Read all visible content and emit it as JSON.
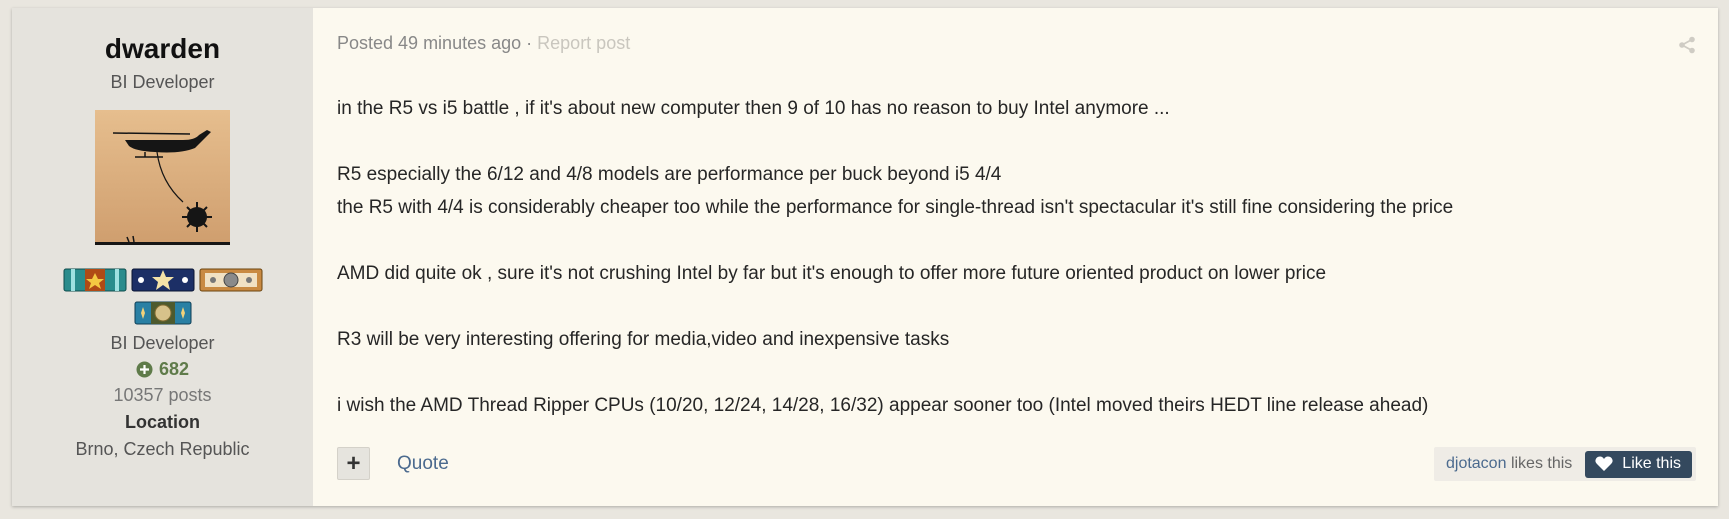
{
  "author": {
    "name": "dwarden",
    "title": "BI Developer",
    "group": "BI Developer",
    "reputation": "682",
    "posts": "10357 posts",
    "location_label": "Location",
    "location_value": "Brno, Czech Republic",
    "badges": [
      "star-ribbon-badge",
      "stars-ribbon-badge",
      "medal-badge",
      "emblem-badge"
    ]
  },
  "post": {
    "posted": "Posted 49 minutes ago",
    "separator": "·",
    "report": "Report post",
    "lines": [
      "in the R5 vs i5 battle , if it's about new computer then 9 of 10 has no reason to buy Intel anymore ...",
      "",
      "R5 especially the 6/12 and 4/8 models are performance per buck beyond i5 4/4",
      "the R5 with 4/4 is considerably cheaper too while the performance for single-thread isn't spectacular it's still fine considering the price",
      "",
      "AMD did quite ok , sure it's not crushing Intel by far but it's enough to offer more future oriented product on lower price",
      "",
      "R3 will be very interesting offering for media,video and inexpensive tasks",
      "",
      "i wish the AMD Thread Ripper CPUs (10/20, 12/24, 14/28, 16/32) appear sooner too (Intel moved theirs HEDT line release ahead)"
    ]
  },
  "actions": {
    "plus": "+",
    "quote": "Quote",
    "likes_user": "djotacon",
    "likes_suffix": "likes this",
    "like_button": "Like this"
  },
  "colors": {
    "post_bg": "#fcf9ef",
    "author_bg": "#e5e3dd",
    "link": "#4b6a8e",
    "reputation": "#5f7b4a",
    "like_button": "#34495e"
  }
}
